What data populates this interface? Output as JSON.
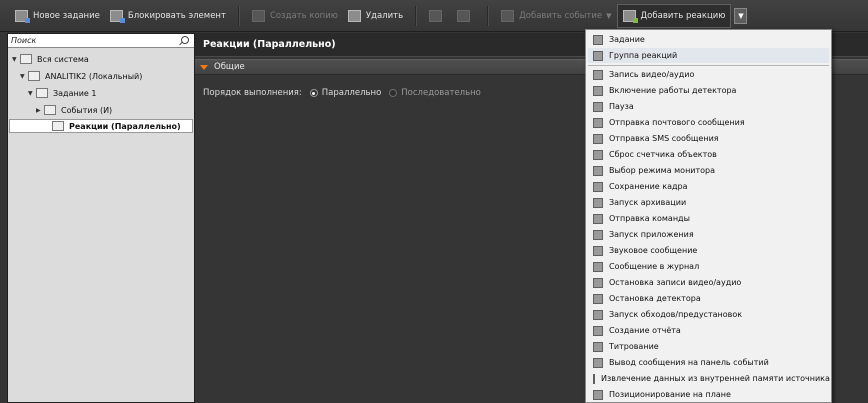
{
  "toolbar": {
    "new_task": "Новое задание",
    "block_element": "Блокировать элемент",
    "create_copy": "Создать копию",
    "delete": "Удалить",
    "add_event": "Добавить событие",
    "add_reaction": "Добавить реакцию"
  },
  "search": {
    "placeholder": "Поиск"
  },
  "tree": {
    "root": "Вся система",
    "server": "ANALITIK2 (Локальный)",
    "task": "Задание 1",
    "events": "События (И)",
    "reactions": "Реакции (Параллельно)"
  },
  "panel": {
    "title": "Реакции (Параллельно)",
    "section": "Общие",
    "order_label": "Порядок выполнения:",
    "parallel": "Параллельно",
    "sequential": "Последовательно",
    "selected_order": "Параллельно"
  },
  "menu": {
    "items": [
      {
        "label": "Задание",
        "icon": "task-icon"
      },
      {
        "label": "Группа реакций",
        "icon": "reaction-group-icon"
      },
      {
        "label": "Запись видео/аудио",
        "icon": "video-record-icon"
      },
      {
        "label": "Включение работы детектора",
        "icon": "detector-on-icon"
      },
      {
        "label": "Пауза",
        "icon": "pause-icon"
      },
      {
        "label": "Отправка почтового сообщения",
        "icon": "mail-icon"
      },
      {
        "label": "Отправка SMS сообщения",
        "icon": "sms-icon"
      },
      {
        "label": "Сброс счетчика объектов",
        "icon": "counter-reset-icon"
      },
      {
        "label": "Выбор режима монитора",
        "icon": "monitor-mode-icon"
      },
      {
        "label": "Сохранение кадра",
        "icon": "frame-save-icon"
      },
      {
        "label": "Запуск архивации",
        "icon": "archive-icon"
      },
      {
        "label": "Отправка команды",
        "icon": "command-icon"
      },
      {
        "label": "Запуск приложения",
        "icon": "app-launch-icon"
      },
      {
        "label": "Звуковое сообщение",
        "icon": "sound-icon"
      },
      {
        "label": "Сообщение в журнал",
        "icon": "log-icon"
      },
      {
        "label": "Остановка записи видео/аудио",
        "icon": "record-stop-icon"
      },
      {
        "label": "Остановка детектора",
        "icon": "detector-stop-icon"
      },
      {
        "label": "Запуск обходов/предустановок",
        "icon": "patrol-icon"
      },
      {
        "label": "Создание отчёта",
        "icon": "report-icon"
      },
      {
        "label": "Титрование",
        "icon": "caption-icon"
      },
      {
        "label": "Вывод сообщения на панель событий",
        "icon": "event-panel-icon"
      },
      {
        "label": "Извлечение данных из внутренней памяти источника",
        "icon": "data-extract-icon"
      },
      {
        "label": "Позиционирование на плане",
        "icon": "map-pin-icon"
      }
    ]
  }
}
